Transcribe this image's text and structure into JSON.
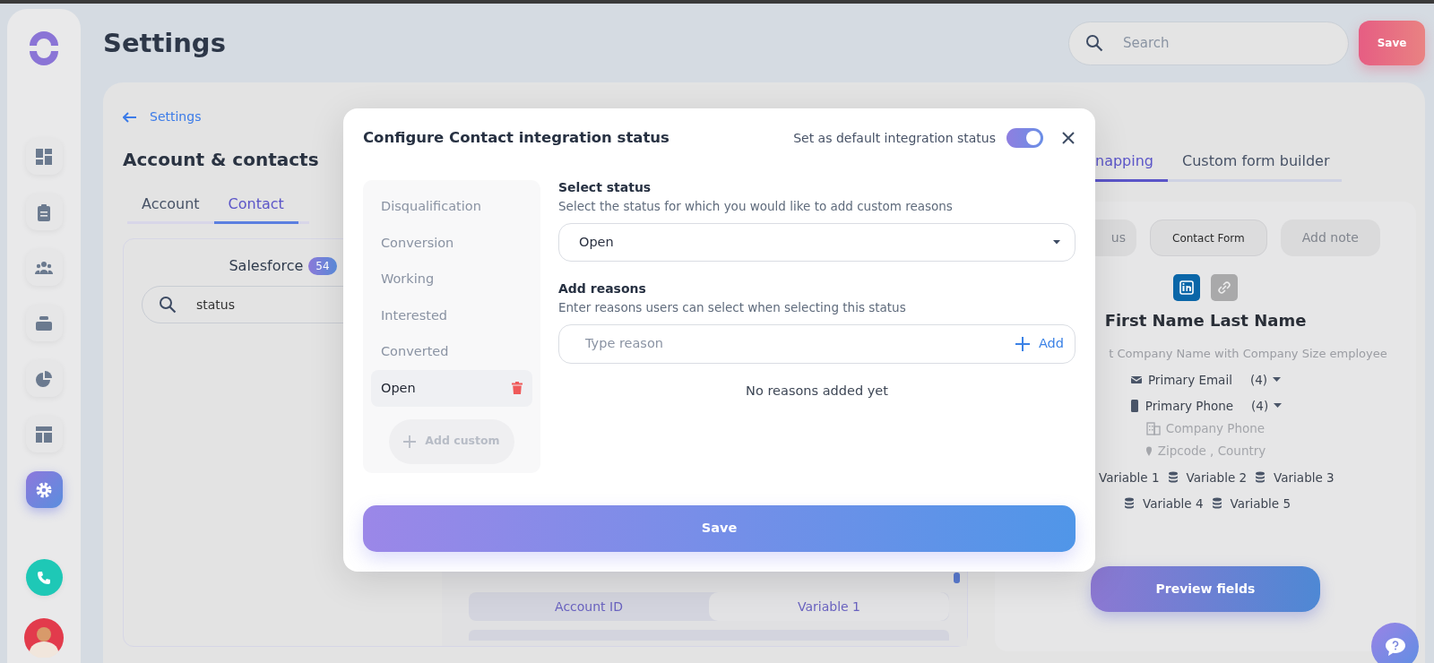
{
  "sidebar": {
    "items": [
      {
        "kind": "dashboard",
        "selected": false
      },
      {
        "kind": "clipboard",
        "selected": false
      },
      {
        "kind": "people",
        "selected": false
      },
      {
        "kind": "stack",
        "selected": false
      },
      {
        "kind": "pie",
        "selected": false
      },
      {
        "kind": "layout",
        "selected": false
      },
      {
        "kind": "gear",
        "selected": true
      }
    ]
  },
  "header": {
    "title": "Settings",
    "search": {
      "placeholder": "Search"
    },
    "save_button": "Save"
  },
  "panel": {
    "back_link": "Settings",
    "title": "Account & contacts",
    "tabs": [
      {
        "label": "Account",
        "selected": false
      },
      {
        "label": "Contact",
        "selected": true
      }
    ],
    "source": {
      "name": "Salesforce",
      "count": "54"
    },
    "search": {
      "value": "status"
    },
    "mapping_rows": [
      {
        "field": "Account ID",
        "variable": "Variable 1"
      }
    ]
  },
  "right_panel": {
    "tabs": [
      {
        "label": "napping",
        "selected": true
      },
      {
        "label": "Custom form builder",
        "selected": false
      }
    ],
    "chips": [
      {
        "label": "us",
        "selected": false
      },
      {
        "label": "Contact Form",
        "selected": true
      },
      {
        "label": "Add note",
        "selected": false
      }
    ],
    "name": "First Name Last Name",
    "company_line": "t Company Name with Company Size employee",
    "fields": [
      {
        "kind": "email",
        "label": "Primary Email",
        "count": "(4)"
      },
      {
        "kind": "phone",
        "label": "Primary Phone",
        "count": "(4)"
      },
      {
        "kind": "company",
        "label": "Company Phone"
      },
      {
        "kind": "location",
        "label": "Zipcode , Country"
      }
    ],
    "variables": [
      [
        "Variable 1",
        "Variable 2",
        "Variable 3"
      ],
      [
        "Variable 4",
        "Variable 5"
      ]
    ],
    "preview_button": "Preview fields"
  },
  "modal": {
    "title": "Configure Contact integration status",
    "default_toggle": {
      "label": "Set as default integration status",
      "on": true
    },
    "statuses": [
      {
        "label": "Disqualification",
        "selected": false
      },
      {
        "label": "Conversion",
        "selected": false
      },
      {
        "label": "Working",
        "selected": false
      },
      {
        "label": "Interested",
        "selected": false
      },
      {
        "label": "Converted",
        "selected": false
      },
      {
        "label": "Open",
        "selected": true
      }
    ],
    "add_custom": "Add custom",
    "select_status": {
      "label": "Select status",
      "hint": "Select the status for which you would like to add custom reasons",
      "value": "Open"
    },
    "add_reasons": {
      "label": "Add reasons",
      "hint": "Enter reasons users can select when selecting this status",
      "placeholder": "Type reason",
      "add_button": "Add"
    },
    "empty_text": "No reasons added yet",
    "save_button": "Save"
  }
}
